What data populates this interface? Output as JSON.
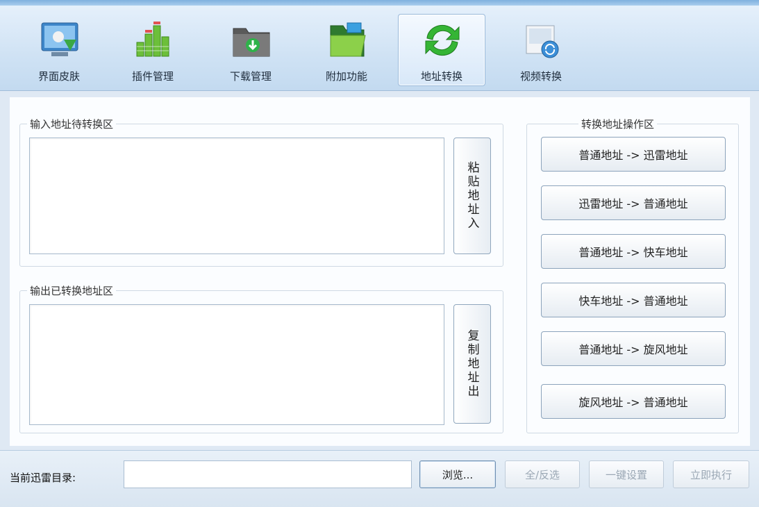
{
  "toolbar": {
    "tools": [
      {
        "label": "界面皮肤",
        "icon": "skin-icon"
      },
      {
        "label": "插件管理",
        "icon": "plugin-icon"
      },
      {
        "label": "下载管理",
        "icon": "download-folder-icon"
      },
      {
        "label": "附加功能",
        "icon": "addon-folder-icon"
      },
      {
        "label": "地址转换",
        "icon": "refresh-arrows-icon",
        "active": true
      },
      {
        "label": "视频转换",
        "icon": "video-convert-icon"
      }
    ]
  },
  "input_group": {
    "title": "输入地址待转换区",
    "paste_button": "粘贴地址入"
  },
  "output_group": {
    "title": "输出已转换地址区",
    "copy_button": "复制地址出"
  },
  "convert_group": {
    "title": "转换地址操作区",
    "buttons": [
      "普通地址 -> 迅雷地址",
      "迅雷地址 -> 普通地址",
      "普通地址 -> 快车地址",
      "快车地址 -> 普通地址",
      "普通地址 -> 旋风地址",
      "旋风地址 -> 普通地址"
    ]
  },
  "bottom": {
    "dir_label": "当前迅雷目录:",
    "dir_value": "",
    "browse_button": "浏览...",
    "select_all_button": "全/反选",
    "one_click_button": "一键设置",
    "execute_button": "立即执行"
  }
}
